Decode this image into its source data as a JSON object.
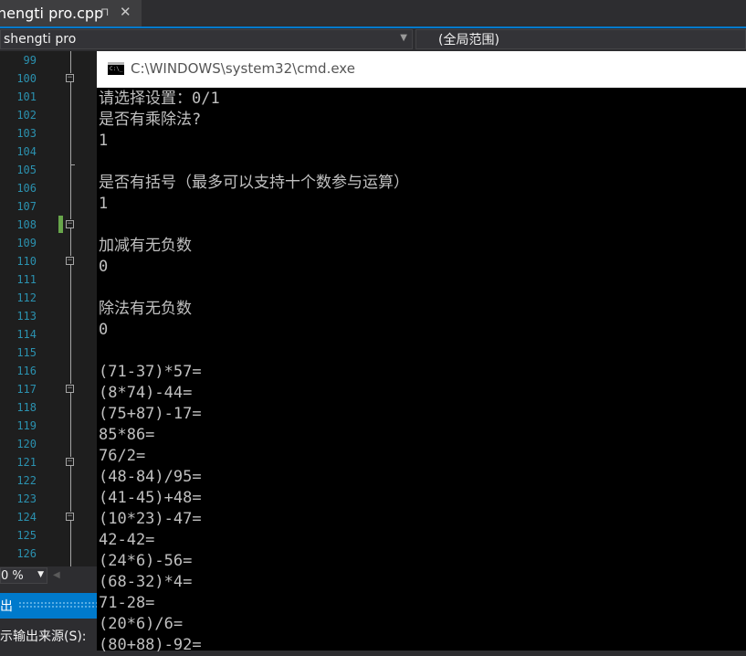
{
  "tab": {
    "title": "hengti pro.cpp",
    "pin_icon": "pin-icon",
    "close_icon": "close-icon",
    "pin_glyph": "⊓",
    "close_glyph": "✕"
  },
  "nav": {
    "project": "shengti pro",
    "scope": "(全局范围)"
  },
  "gutter": {
    "line_numbers": [
      "99",
      "100",
      "101",
      "102",
      "103",
      "104",
      "105",
      "106",
      "107",
      "108",
      "109",
      "110",
      "111",
      "112",
      "113",
      "114",
      "115",
      "116",
      "117",
      "118",
      "119",
      "120",
      "121",
      "122",
      "123",
      "124",
      "125",
      "126"
    ],
    "fold_marker": "−",
    "change_color": "#68a64b"
  },
  "zoom": {
    "value": "0 %"
  },
  "output": {
    "header": "出",
    "source_label": "示输出来源(S):"
  },
  "cmd": {
    "title": "C:\\WINDOWS\\system32\\cmd.exe",
    "icon_text": "C:\\_",
    "lines": [
      "请选择设置：0/1",
      "是否有乘除法?",
      "1",
      "",
      "是否有括号（最多可以支持十个数参与运算）",
      "1",
      "",
      "加减有无负数",
      "0",
      "",
      "除法有无负数",
      "0",
      "",
      "(71-37)*57=",
      "(8*74)-44=",
      "(75+87)-17=",
      "85*86=",
      "76/2=",
      "(48-84)/95=",
      "(41-45)+48=",
      "(10*23)-47=",
      "42-42=",
      "(24*6)-56=",
      "(68-32)*4=",
      "71-28=",
      "(20*6)/6=",
      "(80+88)-92="
    ]
  },
  "colors": {
    "accent": "#007acc",
    "line_number": "#2b91af",
    "console_text": "#c0c0c0"
  }
}
